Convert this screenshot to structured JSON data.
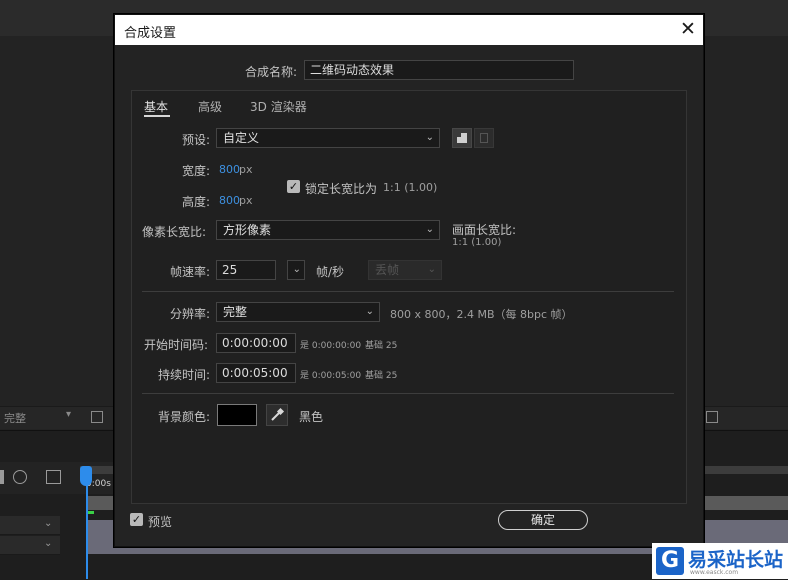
{
  "background_app": {
    "resolution_value": "完整",
    "timeline_time": "0:00s"
  },
  "dialog": {
    "title": "合成设置",
    "comp_name_label": "合成名称:",
    "comp_name_value": "二维码动态效果",
    "tabs": [
      {
        "label": "基本",
        "active": true
      },
      {
        "label": "高级",
        "active": false
      },
      {
        "label": "3D 渲染器",
        "active": false
      }
    ],
    "preset": {
      "label": "预设:",
      "value": "自定义"
    },
    "width": {
      "label": "宽度:",
      "value": "800",
      "unit": "px"
    },
    "height": {
      "label": "高度:",
      "value": "800",
      "unit": "px"
    },
    "lock_aspect": {
      "label": "锁定长宽比为",
      "value": "1:1 (1.00)",
      "checked": true
    },
    "pixel_aspect": {
      "label": "像素长宽比:",
      "value": "方形像素"
    },
    "frame_aspect": {
      "label": "画面长宽比:",
      "value": "1:1 (1.00)"
    },
    "frame_rate": {
      "label": "帧速率:",
      "value": "25",
      "unit": "帧/秒",
      "drop_frame": "丢帧"
    },
    "resolution": {
      "label": "分辨率:",
      "value": "完整",
      "info": "800 x 800，2.4 MB（每 8bpc 帧）"
    },
    "start_timecode": {
      "label": "开始时间码:",
      "value": "0:00:00:00",
      "equals": "是 0:00:00:00",
      "base": "基础 25"
    },
    "duration": {
      "label": "持续时间:",
      "value": "0:00:05:00",
      "equals": "是 0:00:05:00",
      "base": "基础 25"
    },
    "bg_color": {
      "label": "背景颜色:",
      "name": "黑色",
      "color": "#000000"
    },
    "preview": {
      "label": "预览",
      "checked": true
    },
    "ok_label": "确定"
  },
  "watermark": {
    "logo_glyph": "G",
    "text": "易采站长站",
    "sub": "www.easck.com"
  }
}
